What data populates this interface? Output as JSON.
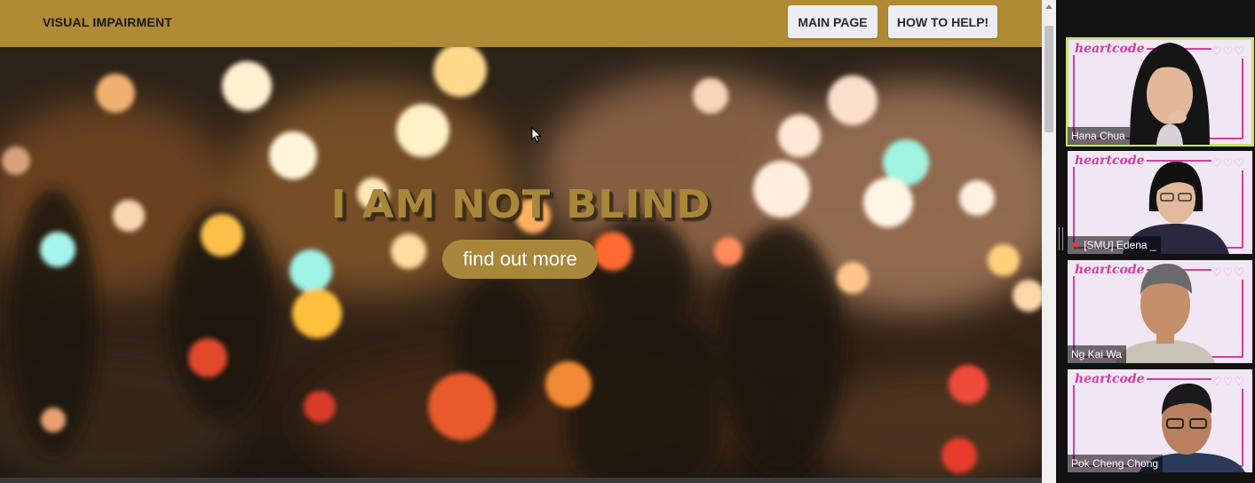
{
  "site": {
    "title": "VISUAL IMPAIRMENT",
    "nav": {
      "main_page": "MAIN PAGE",
      "how_to_help": "HOW TO HELP!"
    },
    "hero": {
      "headline": "I AM NOT BLIND",
      "cta": "find out more"
    }
  },
  "meeting": {
    "tile_logo": "heartcode",
    "tile_hearts": "♡♡♡",
    "participants": [
      {
        "name": "Hana Chua",
        "active_speaker": true,
        "muted": false
      },
      {
        "name": "[SMU] Edena _",
        "active_speaker": false,
        "muted": true
      },
      {
        "name": "Ng Kai Wa",
        "active_speaker": false,
        "muted": false
      },
      {
        "name": "Pok Cheng Chong",
        "active_speaker": false,
        "muted": false
      }
    ]
  },
  "colors": {
    "nav_bar": "#b08a35",
    "accent_gold": "#a8873a",
    "active_speaker_border": "#c6e86a",
    "tile_frame": "#d23ea5"
  },
  "icons": {
    "cursor": "pointer-cursor-icon",
    "mute": "mic-muted-icon"
  }
}
